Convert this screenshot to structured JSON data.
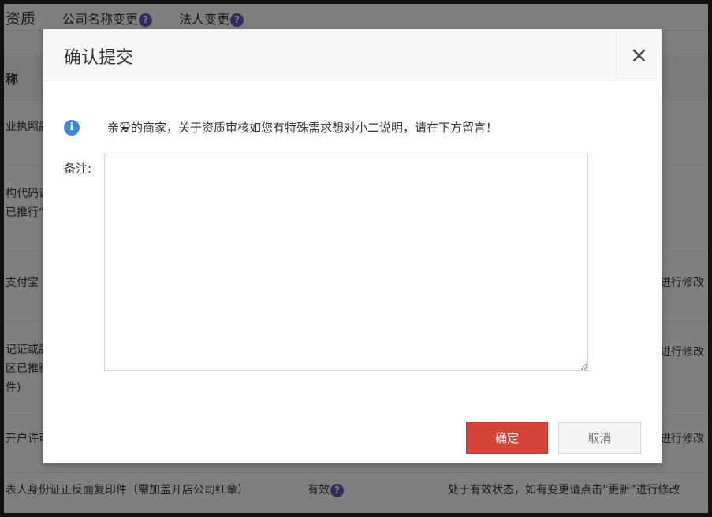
{
  "background": {
    "tabs": [
      {
        "label": "资质"
      },
      {
        "label": "公司名称变更"
      },
      {
        "label": "法人变更"
      }
    ],
    "table_header": "称",
    "rows": [
      {
        "col1": "业执照副"
      },
      {
        "col1_line1": "构代码证",
        "col1_line2": "已推行“"
      },
      {
        "col1": "支付宝",
        "col3": "进行修改"
      },
      {
        "col1_line1": "记证或副",
        "col1_line2": "区已推行",
        "col1_line3": "件)",
        "col3": "进行修改"
      },
      {
        "col1": "开户许可",
        "col3": "进行修改"
      },
      {
        "col1": "表人身份证正反面复印件（需加盖开店公司红章）",
        "col2": "有效",
        "col3": "处于有效状态，如有变更请点击“更新”进行修改"
      }
    ]
  },
  "modal": {
    "title": "确认提交",
    "close_symbol": "×",
    "info_text": "亲爱的商家，关于资质审核如您有特殊需求想对小二说明，请在下方留言！",
    "remark_label": "备注:",
    "remark_value": "",
    "remark_placeholder": "",
    "ok_label": "确定",
    "cancel_label": "取消"
  },
  "colors": {
    "primary_button": "#d6433a",
    "info_icon": "#3b8ad9",
    "help_icon": "#6e55c4"
  }
}
